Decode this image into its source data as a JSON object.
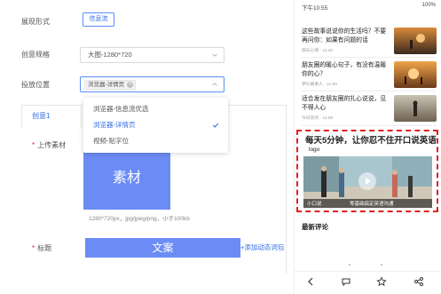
{
  "form": {
    "display_label": "展现形式",
    "display_button": "信息流",
    "spec_label": "创意规格",
    "spec_value": "大图-1280*720",
    "position_label": "投放位置",
    "position_tag": "浏览器-详情页",
    "tab_label": "创意1",
    "upload_label": "上传素材",
    "asset_label": "素材",
    "hint": "1280*720px，jpg/jpeg/png，小于100kb",
    "title_label": "标题",
    "title_box": "文案",
    "add_link": "+添加动态词包",
    "dropdown": [
      {
        "label": "浏览器-信息流优选",
        "selected": false
      },
      {
        "label": "浏览器-详情页",
        "selected": true
      },
      {
        "label": "视频-贴字位",
        "selected": false
      }
    ]
  },
  "phone": {
    "status_time": "下午10:55",
    "status_right": "100%",
    "news": [
      {
        "title": "这些故事说说你的生活吗？不要再问你：如果有问题的话",
        "meta": "快乐心情 · 11:20"
      },
      {
        "title": "朋友圈的暖心句子，有没有温暖你的心？",
        "meta": "梦幻故事人 · 11:00"
      },
      {
        "title": "适合发在朋友圈的扎心说说，见不得人心",
        "meta": "今日热点 · 11:08"
      }
    ],
    "ad_headline": "每天5分钟，让你忍不住开口说英语",
    "ad_logo": "logo",
    "ad_bar_left": "小口说",
    "ad_bar_right": "零基础搞定英语沟通",
    "comments_title": "最新评论"
  }
}
